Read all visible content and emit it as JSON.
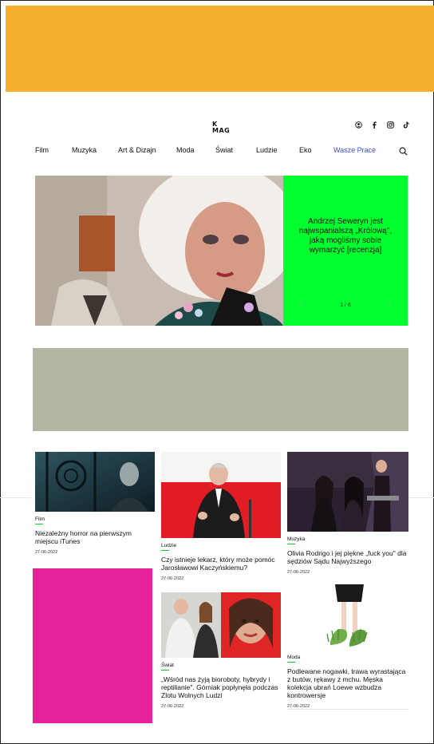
{
  "brand": {
    "logo_line1": "K",
    "logo_line2": "MAG"
  },
  "social_icons": [
    "user-icon",
    "facebook-icon",
    "instagram-icon",
    "tiktok-icon"
  ],
  "nav": {
    "items": [
      "Film",
      "Muzyka",
      "Art & Dizajn",
      "Moda",
      "Świat",
      "Ludzie",
      "Eko",
      "Wasze Prace"
    ],
    "accent_item": "Wasze Prace",
    "accent_color": "#3a4fd0"
  },
  "hero": {
    "title": "Andrzej Seweryn jest najwspanialszą „Królową\", jaką mogliśmy sobie wymarzyć [recenzja]",
    "counter": "1 / 6",
    "panel_color": "#00ff2e"
  },
  "colors": {
    "banner": "#f7b02e",
    "ad": "#b3b8a2",
    "pink_ad": "#e5229a"
  },
  "articles": [
    {
      "category": "Film",
      "title": "Niezależny horror na pierwszym miejscu iTunes",
      "date": "27-06-2022"
    },
    {
      "category": "Ludzie",
      "title": "Czy istnieje lekarz, który może pomóc Jarosławowi Kaczyńskiemu?",
      "date": "27-06-2022"
    },
    {
      "category": "Muzyka",
      "title": "Olivia Rodrigo i jej piękne „fuck you\" dla sędziów Sądu Najwyższego",
      "date": "27-06-2022"
    },
    {
      "category": "Świat",
      "title": "„Wśród nas żyją bioroboty, hybrydy i reptilianie\". Górniak popłynęła podczas Zlotu Wolnych Ludzi",
      "date": "27-06-2022"
    },
    {
      "category": "Moda",
      "title": "Podlewane nogawki, trawa wyrastająca z butów, rękawy z mchu. Męska kolekcja ubrań Loewe wzbudza kontrowersje",
      "date": "27-06-2022"
    }
  ]
}
